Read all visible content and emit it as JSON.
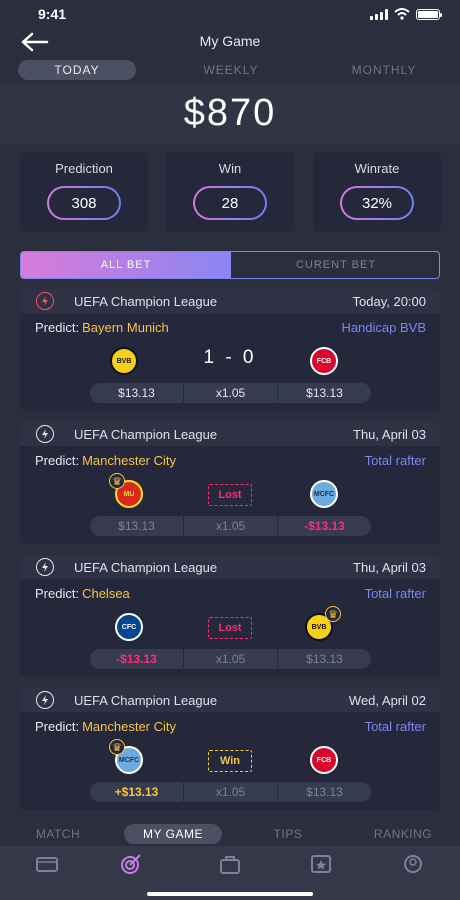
{
  "status_bar": {
    "time": "9:41"
  },
  "header": {
    "title": "My Game"
  },
  "period_tabs": [
    "TODAY",
    "WEEKLY",
    "MONTHLY"
  ],
  "balance": "$870",
  "stats": [
    {
      "label": "Prediction",
      "value": "308"
    },
    {
      "label": "Win",
      "value": "28"
    },
    {
      "label": "Winrate",
      "value": "32%"
    }
  ],
  "bet_tabs": {
    "all": "ALL BET",
    "current": "CURENT BET"
  },
  "matches": [
    {
      "league": "UEFA Champion League",
      "time": "Today, 20:00",
      "predict_label": "Predict:",
      "predict_team": "Bayern Munich",
      "bet_type": "Handicap BVB",
      "score": "1 - 0",
      "odds": [
        "$13.13",
        "x1.05",
        "$13.13"
      ]
    },
    {
      "league": "UEFA Champion League",
      "time": "Thu, April 03",
      "predict_label": "Predict:",
      "predict_team": "Manchester City",
      "bet_type": "Total rafter",
      "result": "Lost",
      "odds": [
        "$13.13",
        "x1.05",
        "-$13.13"
      ]
    },
    {
      "league": "UEFA Champion League",
      "time": "Thu, April 03",
      "predict_label": "Predict:",
      "predict_team": "Chelsea",
      "bet_type": "Total rafter",
      "result": "Lost",
      "odds": [
        "-$13.13",
        "x1.05",
        "$13.13"
      ]
    },
    {
      "league": "UEFA Champion League",
      "time": "Wed, April 02",
      "predict_label": "Predict:",
      "predict_team": "Manchester City",
      "bet_type": "Total rafter",
      "result": "Win",
      "odds": [
        "+$13.13",
        "x1.05",
        "$13.13"
      ]
    }
  ],
  "bottom_tabs": [
    "MATCH",
    "MY GAME",
    "TIPS",
    "RANKING"
  ],
  "nav_icons": [
    "tv-icon",
    "target-icon",
    "bag-icon",
    "star-board-icon",
    "profile-icon"
  ],
  "colors": {
    "background": "#2b2f3d",
    "card": "#24283a",
    "accent_gold": "#f5c542",
    "accent_blue": "#7a86f2",
    "loss_pink": "#ff2d77",
    "gradient_start": "#d87bd9",
    "gradient_end": "#8a86f3"
  }
}
